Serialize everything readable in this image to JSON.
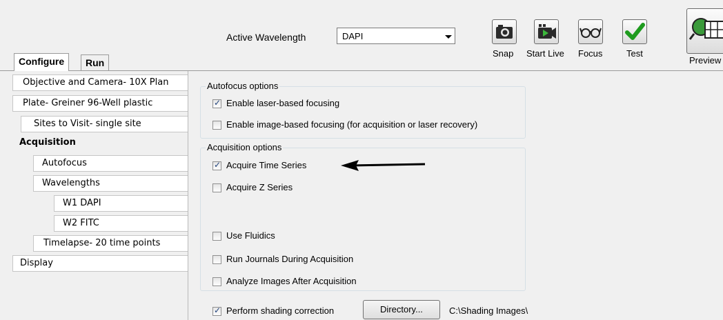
{
  "toolbar": {
    "active_wavelength_label": "Active Wavelength",
    "active_wavelength_value": "DAPI",
    "snap_label": "Snap",
    "start_live_label": "Start Live",
    "focus_label": "Focus",
    "test_label": "Test",
    "preview_label": "Preview",
    "test_icon_color": "#1e9b1e"
  },
  "tabs": [
    {
      "label": "Configure",
      "active": true
    },
    {
      "label": "Run",
      "active": false
    }
  ],
  "nav": {
    "items": [
      {
        "label": "Objective and Camera- 10X Plan"
      },
      {
        "label": "Plate- Greiner 96-Well plastic"
      },
      {
        "label": "Sites to Visit- single site"
      },
      {
        "label": "Acquisition"
      },
      {
        "label": "Autofocus"
      },
      {
        "label": "Wavelengths"
      },
      {
        "label": "W1 DAPI"
      },
      {
        "label": "W2 FITC"
      },
      {
        "label": "Timelapse- 20 time points"
      },
      {
        "label": "Display"
      }
    ]
  },
  "autofocus": {
    "title": "Autofocus options",
    "laser": {
      "label": "Enable laser-based focusing",
      "checked": true
    },
    "image": {
      "label": "Enable image-based focusing (for acquisition or laser recovery)",
      "checked": false
    }
  },
  "acquisition": {
    "title": "Acquisition options",
    "time_series": {
      "label": "Acquire Time Series",
      "checked": true
    },
    "z_series": {
      "label": "Acquire Z Series",
      "checked": false
    },
    "fluidics": {
      "label": "Use Fluidics",
      "checked": false
    },
    "journals": {
      "label": "Run Journals During Acquisition",
      "checked": false
    },
    "analyze": {
      "label": "Analyze Images After Acquisition",
      "checked": false
    }
  },
  "shading": {
    "label": "Perform shading correction",
    "checked": true,
    "directory_button": "Directory...",
    "path": "C:\\Shading Images\\"
  }
}
